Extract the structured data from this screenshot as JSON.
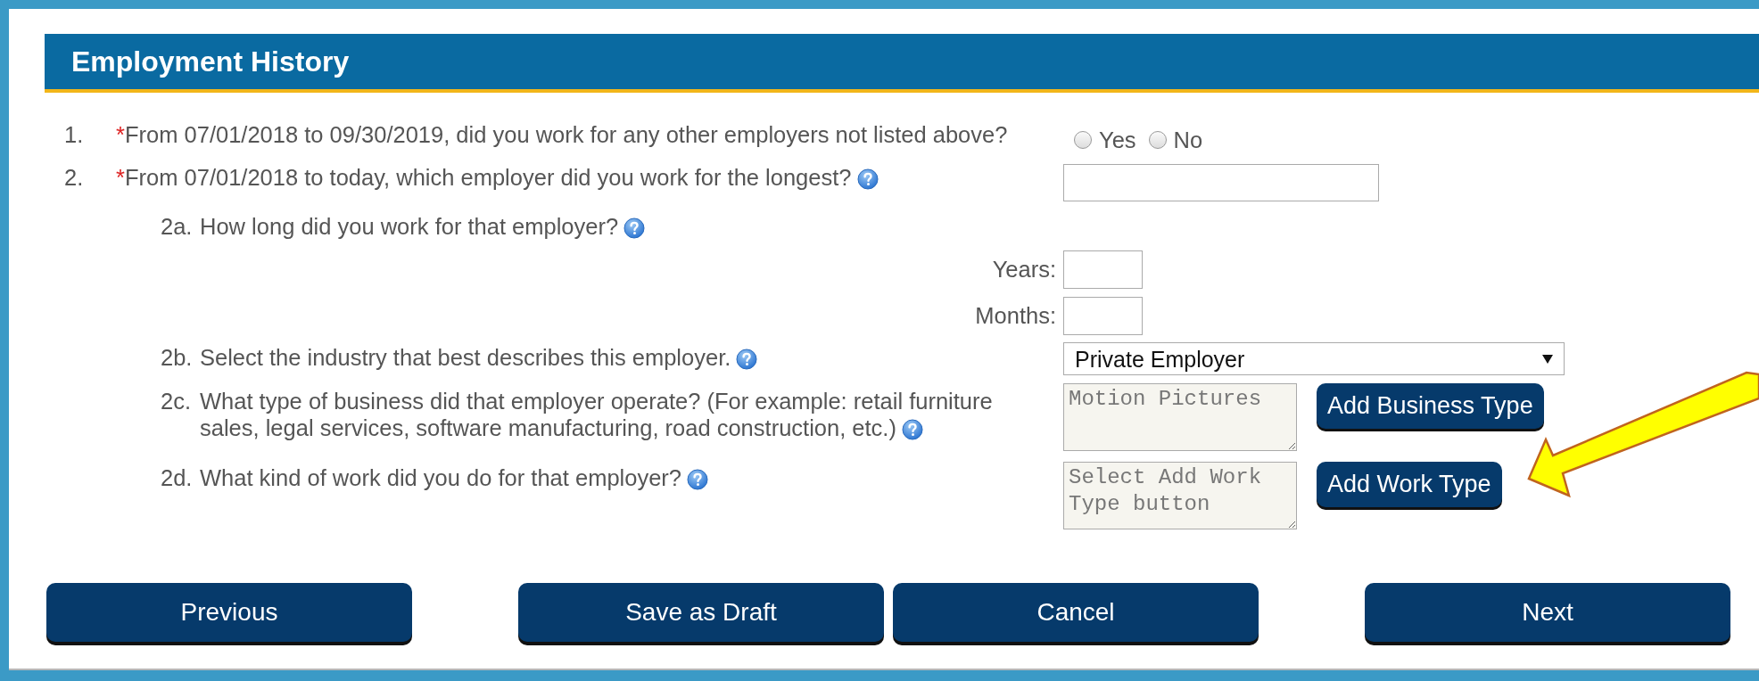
{
  "section": {
    "title": "Employment History"
  },
  "questions": [
    {
      "kind": "radio",
      "number": "1.",
      "marker": "*",
      "text": "From 07/01/2018 to 09/30/2019, did you work for any other employers not listed above?",
      "help": false,
      "options": [
        {
          "label": "Yes",
          "selected": false
        },
        {
          "label": "No",
          "selected": false
        }
      ]
    },
    {
      "kind": "text",
      "number": "2.",
      "marker": "*",
      "text": "From 07/01/2018 to today, which employer did you work for the longest?",
      "help": true
    },
    {
      "kind": "duration",
      "number": "2a.",
      "text": "How long did you work for that employer?",
      "help": true,
      "fields": [
        {
          "label": "Years:"
        },
        {
          "label": "Months:"
        }
      ]
    },
    {
      "kind": "select",
      "number": "2b.",
      "text": "Select the industry that best describes this employer.",
      "help": true,
      "value": "Private Employer"
    },
    {
      "kind": "textarea",
      "number": "2c.",
      "text": "What type of business did that employer operate? (For example: retail furniture sales, legal services, software manufacturing, road construction, etc.)",
      "help": true,
      "value": "Motion Pictures",
      "button": "Add Business Type"
    },
    {
      "kind": "textarea",
      "number": "2d.",
      "text": "What kind of work did you do for that employer?",
      "help": true,
      "placeholder": "Select Add Work Type button",
      "button": "Add Work Type"
    }
  ],
  "buttons": [
    {
      "label": "Previous"
    },
    {
      "label": "Save as Draft"
    },
    {
      "label": "Cancel"
    },
    {
      "label": "Next"
    }
  ]
}
